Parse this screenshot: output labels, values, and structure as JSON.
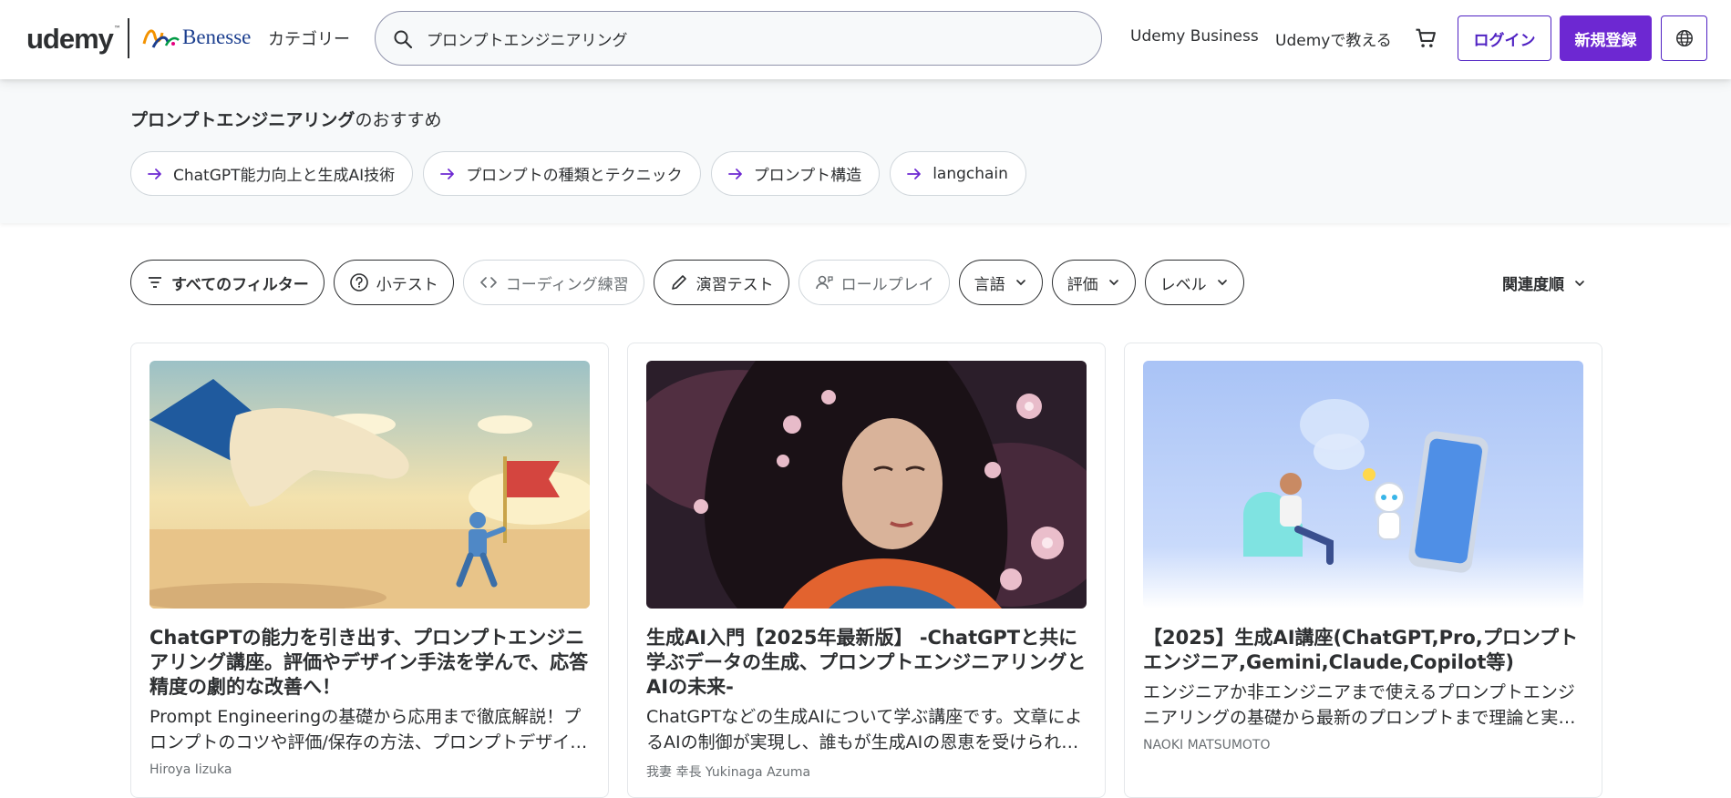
{
  "header": {
    "logo_text": "udemy",
    "partner_logo_text": "Benesse",
    "category_label": "カテゴリー",
    "search_value": "プロンプトエンジニアリング",
    "business_label": "Udemy Business",
    "teach_label": "Udemyで教える",
    "login_label": "ログイン",
    "signup_label": "新規登録",
    "icons": {
      "search": "search-icon",
      "cart": "cart-icon",
      "globe": "globe-icon"
    }
  },
  "suggestions": {
    "title_bold": "プロンプトエンジニアリング",
    "title_rest": "のおすすめ",
    "chips": [
      {
        "label": "ChatGPT能力向上と生成AI技術"
      },
      {
        "label": "プロンプトの種類とテクニック"
      },
      {
        "label": "プロンプト構造"
      },
      {
        "label": "langchain"
      }
    ]
  },
  "filters": {
    "all_filters": "すべてのフィルター",
    "quiz": "小テスト",
    "coding": "コーディング練習",
    "practice_test": "演習テスト",
    "roleplay": "ロールプレイ",
    "language": "言語",
    "rating": "評価",
    "level": "レベル",
    "sort": "関連度順"
  },
  "courses": [
    {
      "title": "ChatGPTの能力を引き出す、プロンプトエンジニアリング講座。評価やデザイン手法を学んで、応答精度の劇的な改善へ！",
      "description": "Prompt Engineeringの基礎から応用まで徹底解説！プロンプトのコツや評価/保存の方法、プロンプトデザインまで",
      "author": "Hiroya Iizuka"
    },
    {
      "title": "生成AI入門【2025年最新版】 -ChatGPTと共に学ぶデータの生成、プロンプトエンジニアリングとAIの未来-",
      "description": "ChatGPTなどの生成AIについて学ぶ講座です。文章によるAIの制御が実現し、誰もが生成AIの恩恵を受けられる時代へ",
      "author": "我妻 幸長 Yukinaga Azuma"
    },
    {
      "title": "【2025】生成AI講座(ChatGPT,Pro,プロンプトエンジニア,Gemini,Claude,Copilot等)",
      "description": "エンジニアか非エンジニアまで使えるプロンプトエンジニアリングの基礎から最新のプロンプトまで理論と実践で学ぶ",
      "author": "NAOKI MATSUMOTO"
    }
  ],
  "colors": {
    "brand_purple": "#6d28d2",
    "login_border": "#5022c3",
    "band_bg": "#f7f9fa"
  }
}
